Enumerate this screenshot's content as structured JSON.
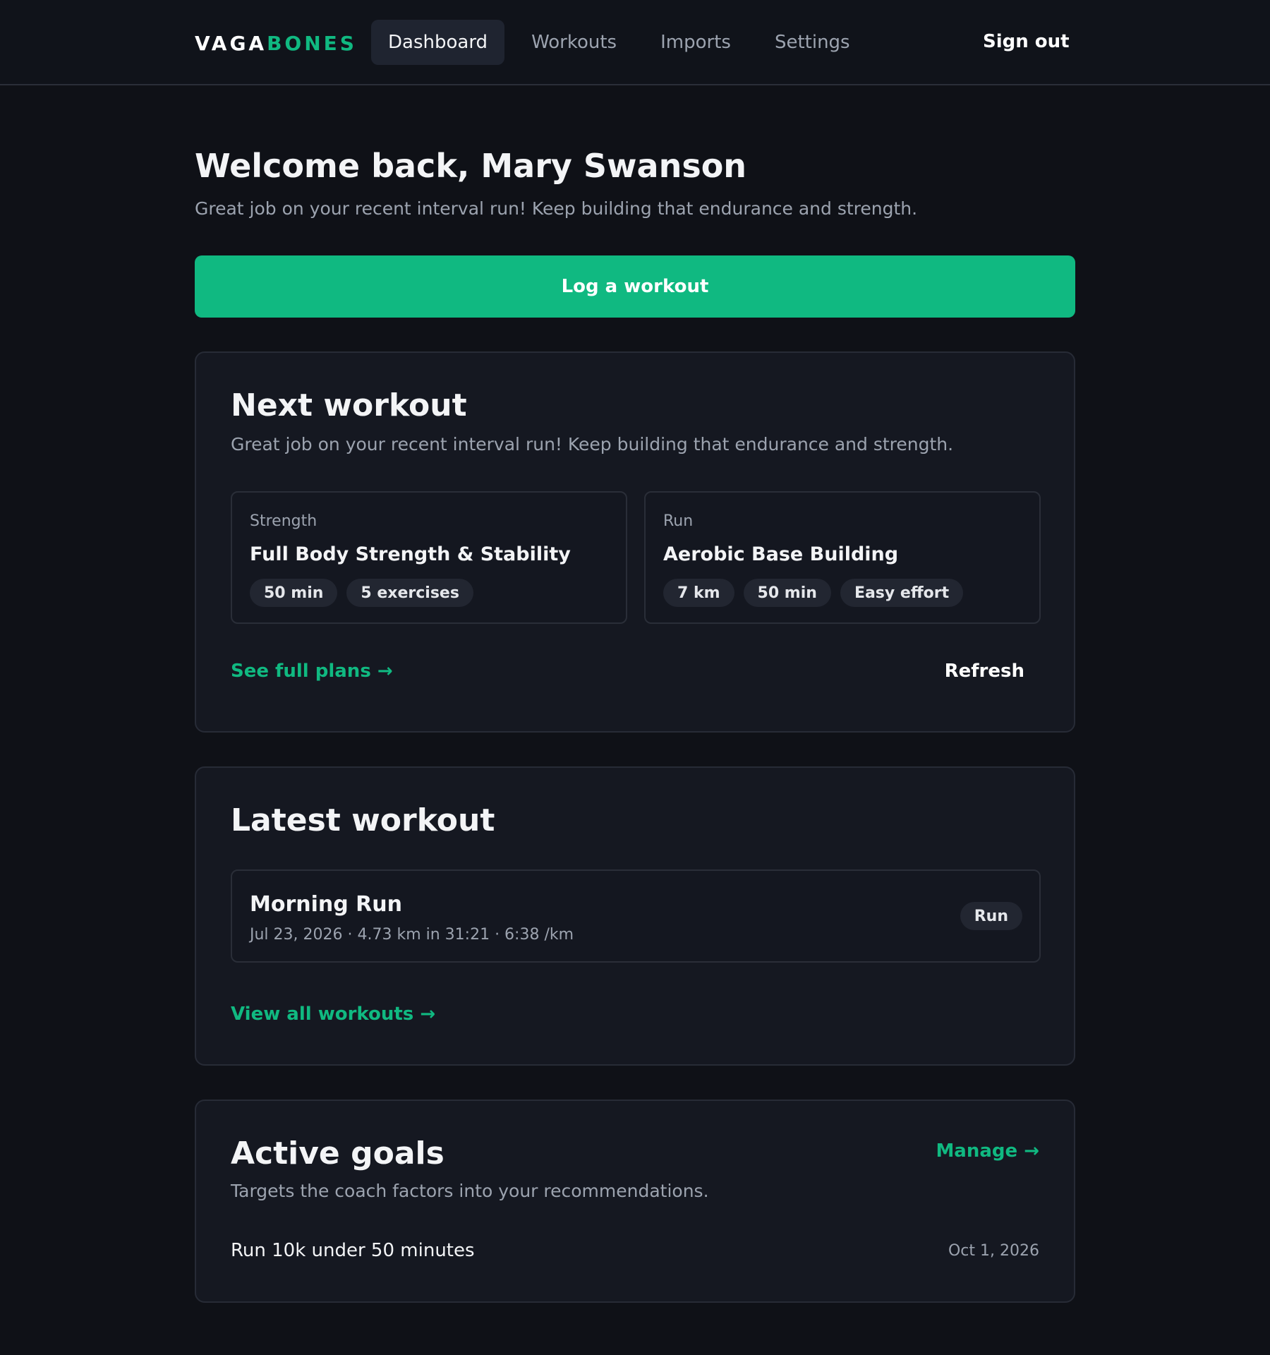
{
  "header": {
    "brand_part1": "VAGA",
    "brand_part2": "BONES",
    "nav": [
      "Dashboard",
      "Workouts",
      "Imports",
      "Settings"
    ],
    "active_nav": "Dashboard",
    "sign_out": "Sign out"
  },
  "welcome": {
    "title": "Welcome back, Mary Swanson",
    "subtitle": "Great job on your recent interval run! Keep building that endurance and strength."
  },
  "log_button": "Log a workout",
  "next_workout": {
    "title": "Next workout",
    "subtitle": "Great job on your recent interval run! Keep building that endurance and strength.",
    "plans": [
      {
        "kind": "Strength",
        "name": "Full Body Strength & Stability",
        "chips": [
          "50 min",
          "5 exercises"
        ]
      },
      {
        "kind": "Run",
        "name": "Aerobic Base Building",
        "chips": [
          "7 km",
          "50 min",
          "Easy effort"
        ]
      }
    ],
    "see_plans": "See full plans →",
    "refresh": "Refresh"
  },
  "latest_workout": {
    "title": "Latest workout",
    "name": "Morning Run",
    "meta": "Jul 23, 2026 · 4.73 km in 31:21 · 6:38 /km",
    "badge": "Run",
    "view_all": "View all workouts →"
  },
  "active_goals": {
    "title": "Active goals",
    "manage": "Manage →",
    "subtitle": "Targets the coach factors into your recommendations.",
    "goals": [
      {
        "name": "Run 10k under 50 minutes",
        "date": "Oct 1, 2026"
      }
    ]
  },
  "colors": {
    "accent": "#10b981",
    "background": "#0f1117",
    "card": "#151821"
  }
}
